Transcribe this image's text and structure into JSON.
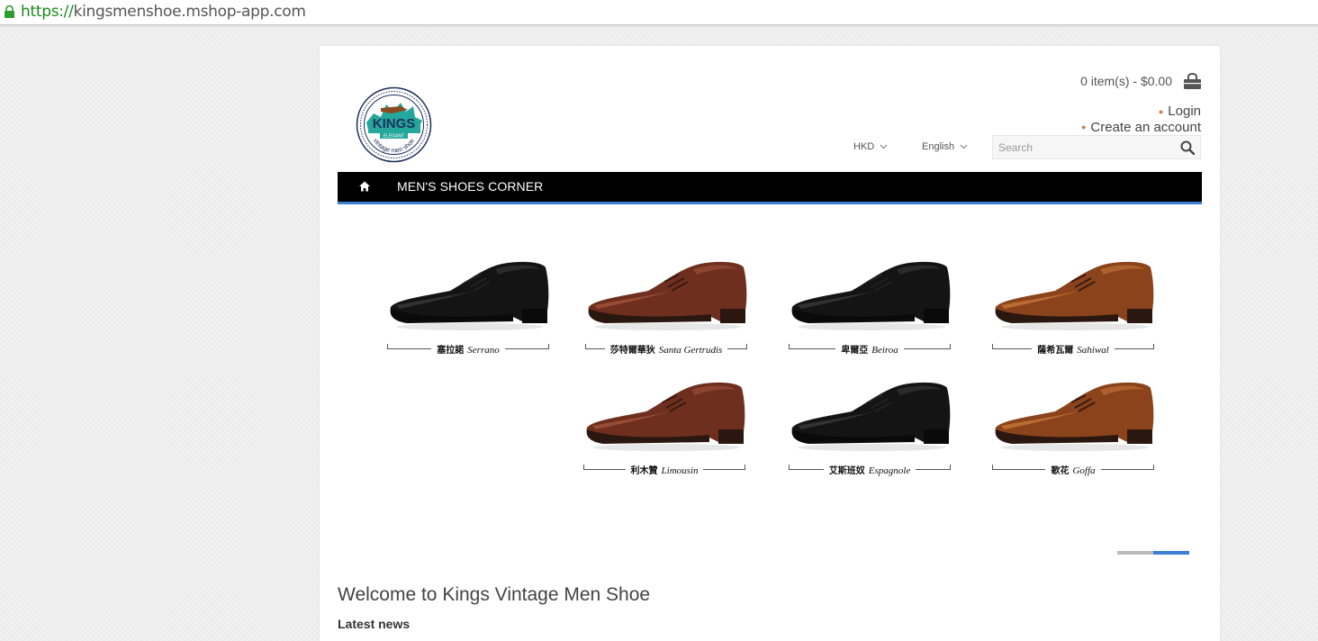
{
  "browser": {
    "url_scheme": "https://",
    "url_host": "kingsmenshoe.mshop-app.com"
  },
  "logo": {
    "brand": "KINGS",
    "sub": "ELEGANT",
    "tagline": "vintage men shoe"
  },
  "cart": {
    "summary": "0 item(s) - $0.00",
    "icon": "shopping-bag-icon"
  },
  "account": {
    "login": "Login",
    "create_account": "Create an account"
  },
  "currency": {
    "selected": "HKD"
  },
  "language": {
    "selected": "English"
  },
  "search": {
    "placeholder": "Search"
  },
  "nav": {
    "home_icon": "home-icon",
    "items": [
      "MEN'S SHOES CORNER"
    ]
  },
  "products": [
    {
      "zh": "塞拉諾",
      "en": "Serrano",
      "color": "black"
    },
    {
      "zh": "莎特爾華狄",
      "en": "Santa Gertrudis",
      "color": "brown"
    },
    {
      "zh": "卑爾亞",
      "en": "Beiroa",
      "color": "black"
    },
    {
      "zh": "薩希瓦爾",
      "en": "Sahiwal",
      "color": "tan"
    },
    {
      "zh": "利木贊",
      "en": "Limousin",
      "color": "brown"
    },
    {
      "zh": "艾斯班奴",
      "en": "Espagnole",
      "color": "black"
    },
    {
      "zh": "歌花",
      "en": "Goffa",
      "color": "tan"
    }
  ],
  "slider": {
    "pages": 2,
    "active_page": 2
  },
  "content": {
    "welcome": "Welcome to Kings Vintage Men Shoe",
    "latest_news": "Latest news"
  },
  "colors": {
    "accent": "#3d7fd4",
    "nav_bg": "#000000",
    "bullet": "#c57b46"
  }
}
